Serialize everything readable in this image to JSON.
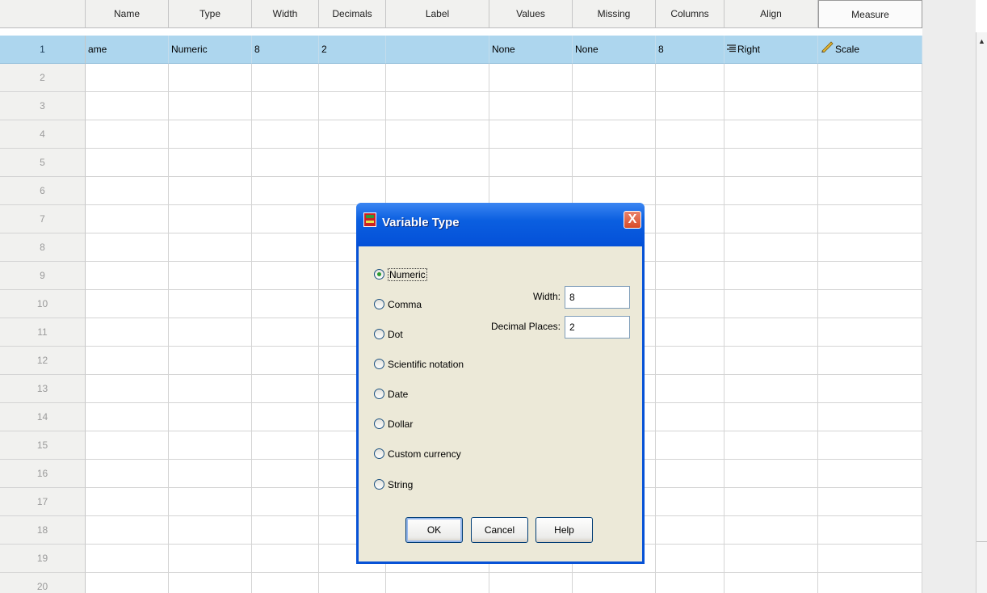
{
  "columns": [
    "Name",
    "Type",
    "Width",
    "Decimals",
    "Label",
    "Values",
    "Missing",
    "Columns",
    "Align",
    "Measure"
  ],
  "row_numbers": [
    "1",
    "2",
    "3",
    "4",
    "5",
    "6",
    "7",
    "8",
    "9",
    "10",
    "11",
    "12",
    "13",
    "14",
    "15",
    "16",
    "17",
    "18",
    "19",
    "20"
  ],
  "row1": {
    "name": "ame",
    "type": "Numeric",
    "width": "8",
    "decimals": "2",
    "label": "",
    "values": "None",
    "missing": "None",
    "columns": "8",
    "align": "Right",
    "measure": "Scale"
  },
  "dialog": {
    "title": "Variable Type",
    "close_glyph": "X",
    "options": [
      "Numeric",
      "Comma",
      "Dot",
      "Scientific notation",
      "Date",
      "Dollar",
      "Custom currency",
      "String"
    ],
    "selected": "Numeric",
    "width_label": "Width:",
    "width_value": "8",
    "decimal_label": "Decimal Places:",
    "decimal_value": "2",
    "ok": "OK",
    "cancel": "Cancel",
    "help": "Help"
  },
  "colors": {
    "selection": "#add6ee",
    "titlebar": "#0752d6",
    "dialog_face": "#ece9d8"
  },
  "icons": {
    "align": "align-right-icon",
    "measure": "ruler-pencil-icon",
    "dialog": "app-icon",
    "scroll": "scroll-up-arrow-icon"
  }
}
